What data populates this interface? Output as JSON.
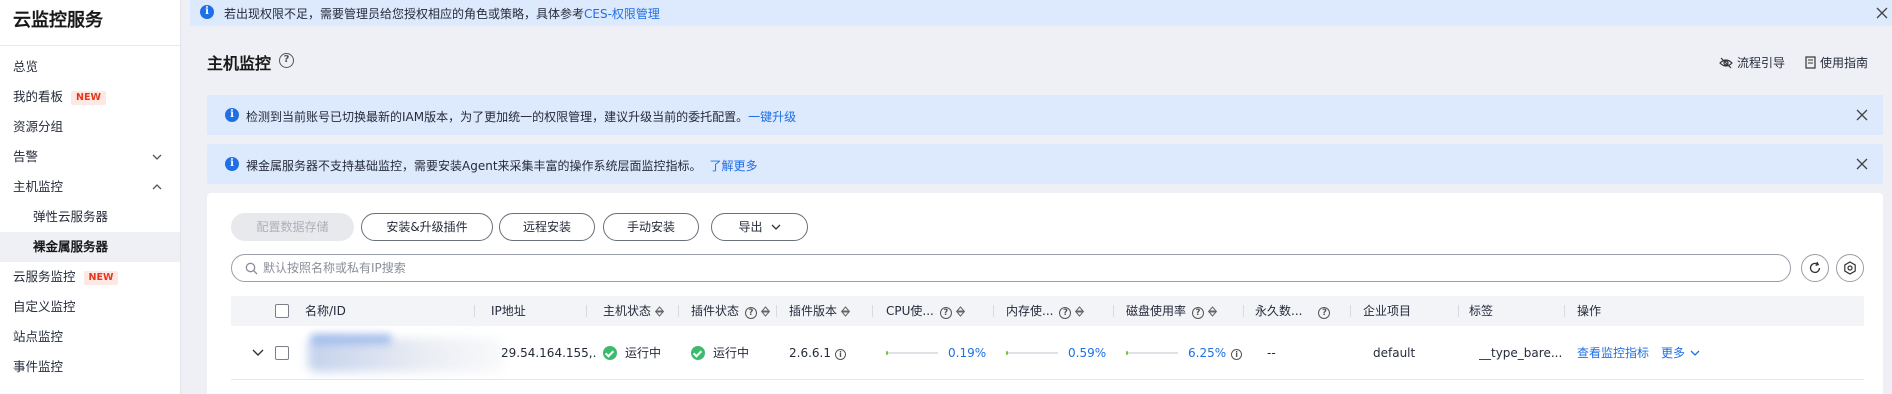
{
  "sidebar": {
    "title": "云监控服务",
    "new_badge": "NEW",
    "items": [
      {
        "label": "总览"
      },
      {
        "label": "我的看板"
      },
      {
        "label": "资源分组"
      },
      {
        "label": "告警"
      },
      {
        "label": "主机监控"
      },
      {
        "label": "弹性云服务器"
      },
      {
        "label": "裸金属服务器"
      },
      {
        "label": "云服务监控"
      },
      {
        "label": "自定义监控"
      },
      {
        "label": "站点监控"
      },
      {
        "label": "事件监控"
      }
    ]
  },
  "top_banner": {
    "text": "若出现权限不足，需要管理员给您授权相应的角色或策略，具体参考",
    "link": "CES-权限管理"
  },
  "header": {
    "title": "主机监控",
    "process_guide": "流程引导",
    "user_guide": "使用指南"
  },
  "notices": [
    {
      "text": "检测到当前账号已切换最新的IAM版本，为了更加统一的权限管理，建议升级当前的委托配置。",
      "link": "一键升级"
    },
    {
      "text": "裸金属服务器不支持基础监控，需要安装Agent来采集丰富的操作系统层面监控指标。",
      "link": "了解更多"
    }
  ],
  "toolbar": {
    "config_storage": "配置数据存储",
    "install_upgrade": "安装&升级插件",
    "remote_install": "远程安装",
    "manual_install": "手动安装",
    "export": "导出"
  },
  "search": {
    "placeholder": "默认按照名称或私有IP搜索"
  },
  "table": {
    "columns": {
      "name": "名称/ID",
      "ip": "IP地址",
      "host_status": "主机状态",
      "plugin_status": "插件状态",
      "plugin_version": "插件版本",
      "cpu": "CPU使...",
      "mem": "内存使...",
      "disk": "磁盘使用率",
      "persist": "永久数...",
      "enterprise": "企业项目",
      "tags": "标签",
      "ops": "操作"
    },
    "rows": [
      {
        "ip": "29.54.164.155,...",
        "host_status": "运行中",
        "plugin_status": "运行中",
        "plugin_version": "2.6.6.1",
        "cpu": "0.19%",
        "mem": "0.59%",
        "disk": "6.25%",
        "persist": "--",
        "enterprise": "default",
        "tags": "__type_bare...",
        "op_view": "查看监控指标",
        "op_more": "更多"
      }
    ]
  },
  "colors": {
    "accent": "#1f6fe5",
    "banner": "#dde9fd",
    "success": "#3dbb6d",
    "new_badge": "#e5371c"
  }
}
